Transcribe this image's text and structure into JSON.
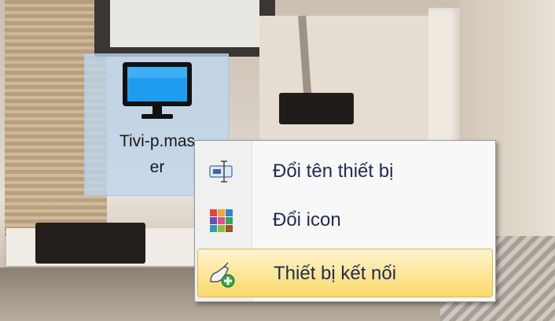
{
  "desktop_icon": {
    "label_line1": "Tivi-p.mas",
    "label_line2": "er",
    "icon": "monitor-icon"
  },
  "context_menu": {
    "items": [
      {
        "label": "Đổi tên thiết bị",
        "icon": "rename-icon",
        "selected": false
      },
      {
        "label": "Đổi icon",
        "icon": "color-grid-icon",
        "selected": false
      },
      {
        "label": "Thiết bị kết nối",
        "icon": "connect-device-icon",
        "selected": true
      }
    ]
  },
  "colors": {
    "selection_highlight": "#fbe08a",
    "icon_selection": "#bed6f0",
    "menu_text": "#1f2a55"
  }
}
